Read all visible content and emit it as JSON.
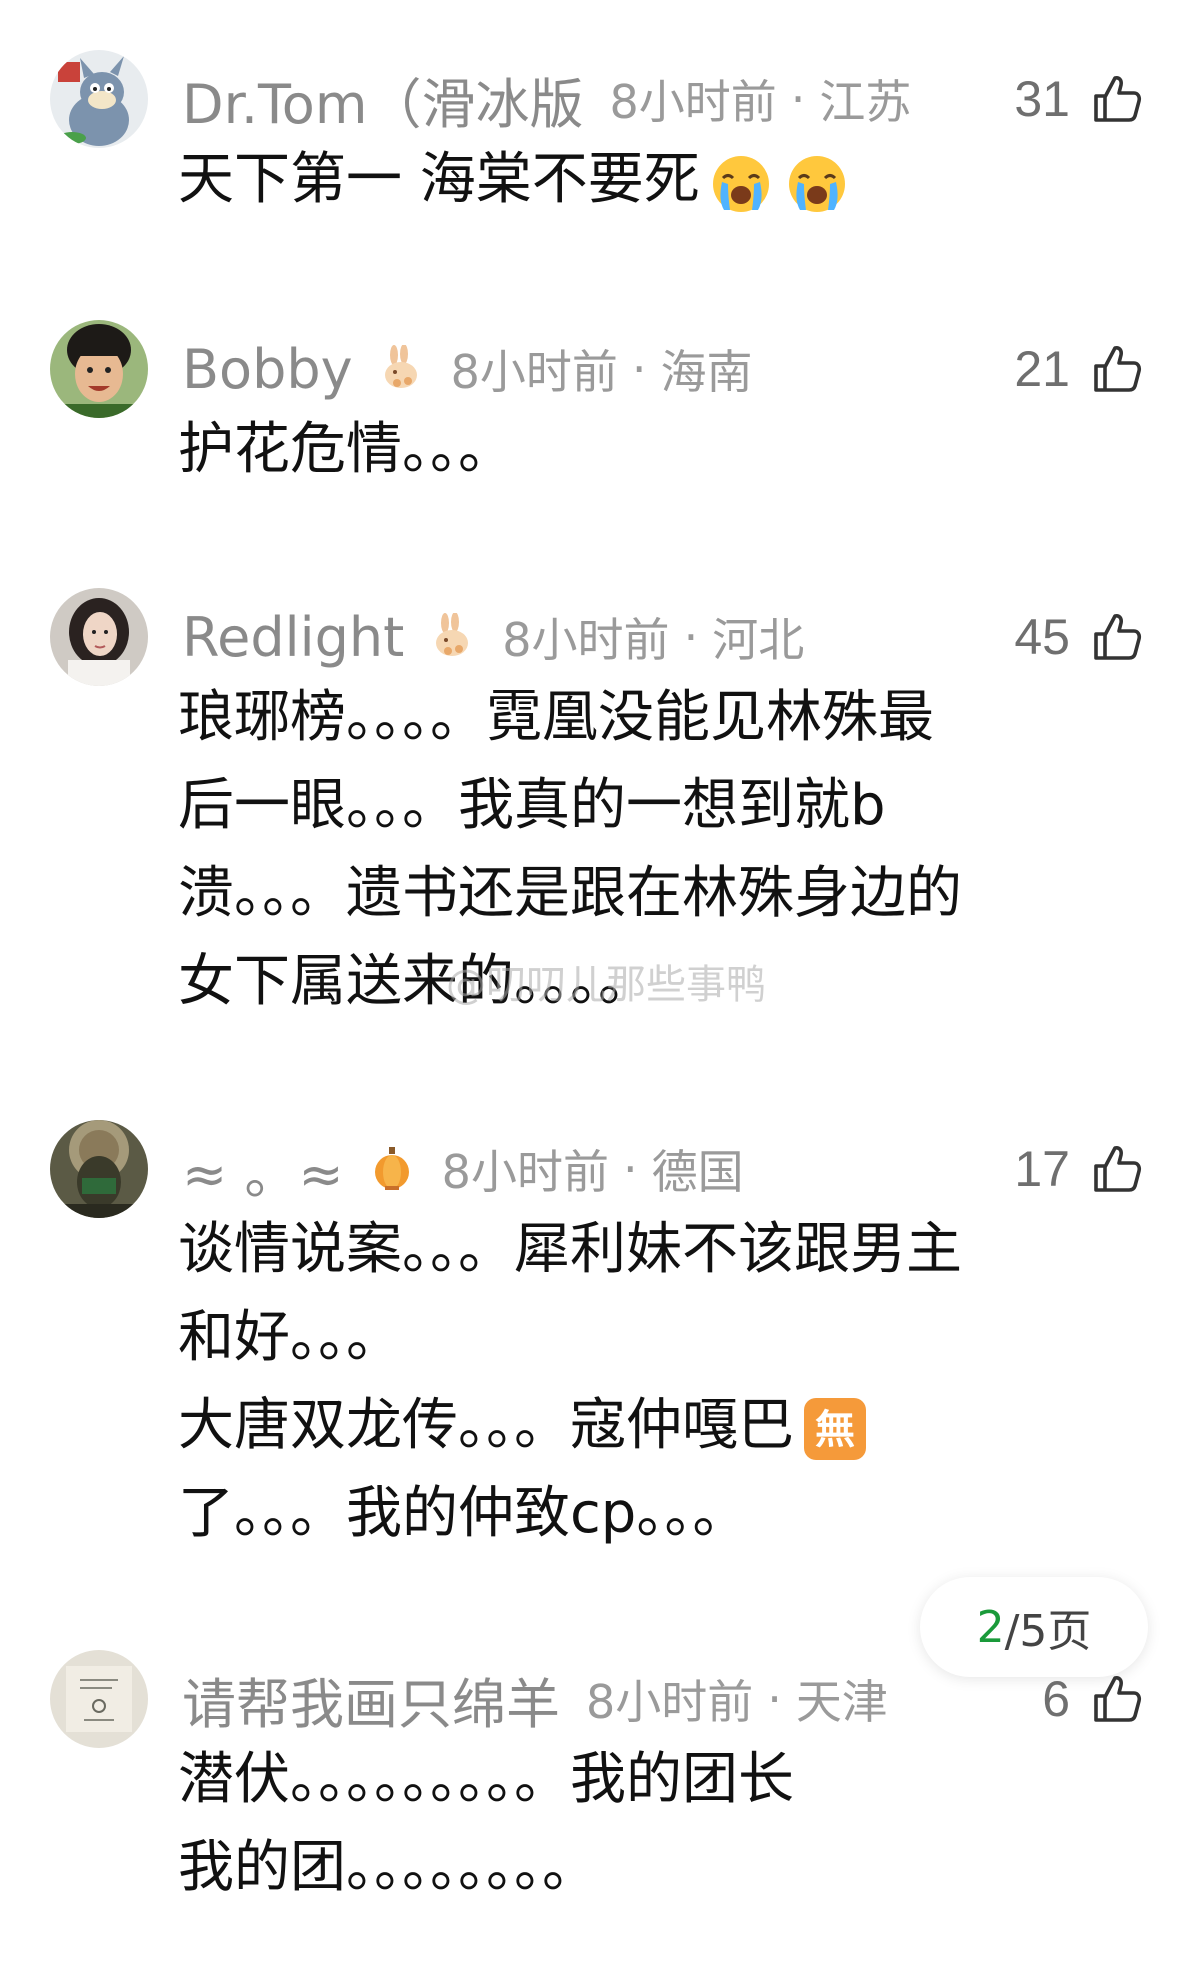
{
  "comments": [
    {
      "name": "Dr.Tom（滑冰版",
      "badge_icon": "",
      "time": "8小时前",
      "location": "江苏",
      "likes": "31",
      "text": "天下第一 海棠不要死",
      "emojis": [
        "crying-face-icon",
        "crying-face-icon"
      ]
    },
    {
      "name": "Bobby",
      "badge_icon": "rabbit-badge-icon",
      "time": "8小时前",
      "location": "海南",
      "likes": "21",
      "text": "护花危情。。。"
    },
    {
      "name": "Redlight",
      "badge_icon": "rabbit-badge-icon",
      "time": "8小时前",
      "location": "河北",
      "likes": "45",
      "text": "琅琊榜。。。。霓凰没能见林殊最\n后一眼。。。我真的一想到就b\n溃。。。遗书还是跟在林殊身边的\n女下属送来的。。。。"
    },
    {
      "name": "≈ 。≈",
      "badge_icon": "lantern-badge-icon",
      "time": "8小时前",
      "location": "德国",
      "likes": "17",
      "text": "谈情说案。。。犀利妹不该跟男主\n和好。。。\n大唐双龙传。。。寇仲嘎巴",
      "text_after_emoji": "\n了。。。我的仲致cp。。。",
      "emoji_label": "無"
    },
    {
      "name": "请帮我画只绵羊",
      "badge_icon": "",
      "time": "8小时前",
      "location": "天津",
      "likes": "6",
      "text": "潜伏。。。。。。。。。我的团长\n我的团。。。。。。。。"
    }
  ],
  "pager": {
    "current": "2",
    "rest": "/5页"
  },
  "watermark": "@叨叨儿那些事鸭",
  "separator": "·",
  "colors": {
    "meta_gray": "#9a9a9a",
    "text": "#111111",
    "pager_current": "#1a9a3a"
  }
}
